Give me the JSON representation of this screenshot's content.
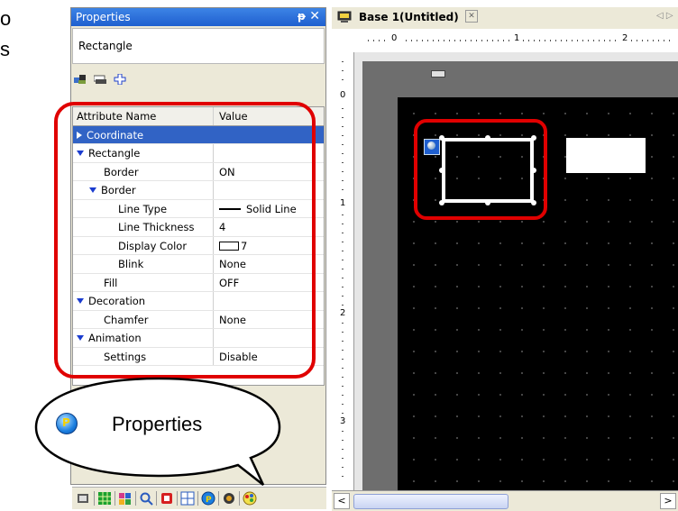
{
  "side_text": {
    "line1": "o",
    "line2": "s"
  },
  "panel": {
    "title": "Properties",
    "pin_glyph": "ᵽ",
    "close_glyph": "✕",
    "object_name": "Rectangle",
    "toolbar_icons": [
      "object-icon",
      "layer-icon",
      "add-icon"
    ],
    "grid": {
      "header": {
        "name": "Attribute Name",
        "value": "Value"
      },
      "rows": [
        {
          "name": "Coordinate",
          "value": ""
        },
        {
          "name": "Rectangle",
          "value": ""
        },
        {
          "name": "Border",
          "value": "ON"
        },
        {
          "name": "Border",
          "value": ""
        },
        {
          "name": "Line Type",
          "value": "Solid Line"
        },
        {
          "name": "Line Thickness",
          "value": "4"
        },
        {
          "name": "Display Color",
          "value": "7"
        },
        {
          "name": "Blink",
          "value": "None"
        },
        {
          "name": "Fill",
          "value": "OFF"
        },
        {
          "name": "Decoration",
          "value": ""
        },
        {
          "name": "Chamfer",
          "value": "None"
        },
        {
          "name": "Animation",
          "value": ""
        },
        {
          "name": "Settings",
          "value": "Disable"
        }
      ]
    },
    "tab_icons": [
      "screen-list-icon",
      "parts-icon",
      "library-icon",
      "search-icon",
      "stop-icon",
      "grid-icon",
      "properties-icon",
      "symbol-icon",
      "palette-icon"
    ]
  },
  "callout": {
    "label": "Properties",
    "badge": "P"
  },
  "editor": {
    "tab_title": "Base 1(Untitled)",
    "close_glyph": "✕",
    "nav_glyph": "◁ ▷",
    "ruler_h_labels": [
      "0",
      "1",
      "2"
    ],
    "ruler_v_labels": [
      "0",
      "1",
      "2",
      "3"
    ],
    "scroll_left": "<",
    "scroll_right": ">"
  },
  "colors": {
    "selection": "#3163c5",
    "highlight": "#e00000",
    "title_bar": "#2b6fdb"
  }
}
